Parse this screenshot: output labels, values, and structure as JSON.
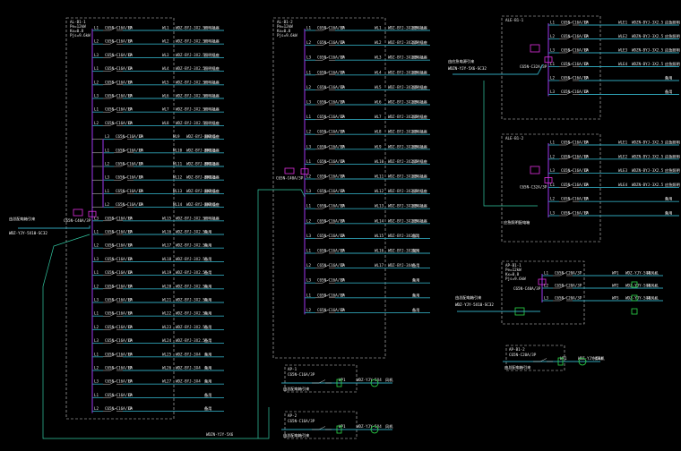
{
  "panels": [
    {
      "id": "AL-B1-1",
      "rows": [
        {
          "n": "L1",
          "brk": "C65N-C16A/1P",
          "a": "6A",
          "c": "WL1",
          "cable": "WDZ-BYJ-3X2.5",
          "load": "照明插座"
        },
        {
          "n": "L2",
          "brk": "C65N-C16A/1P",
          "a": "6A",
          "c": "WL2",
          "cable": "WDZ-BYJ-3X2.5",
          "load": "照明插座"
        },
        {
          "n": "L3",
          "brk": "C65N-C16A/1P",
          "a": "6A",
          "c": "WL3",
          "cable": "WDZ-BYJ-3X2.5",
          "load": "照明插座"
        },
        {
          "n": "L1",
          "brk": "C65N-C16A/1P",
          "a": "6A",
          "c": "WL4",
          "cable": "WDZ-BYJ-3X2.5",
          "load": "照明插座"
        },
        {
          "n": "L2",
          "brk": "C65N-C16A/1P",
          "a": "6A",
          "c": "WL5",
          "cable": "WDZ-BYJ-3X2.5",
          "load": "照明插座"
        },
        {
          "n": "L3",
          "brk": "C65N-C16A/1P",
          "a": "6A",
          "c": "WL6",
          "cable": "WDZ-BYJ-3X2.5",
          "load": "照明插座"
        },
        {
          "n": "L1",
          "brk": "C65N-C16A/1P",
          "a": "6A",
          "c": "WL7",
          "cable": "WDZ-BYJ-3X2.5",
          "load": "照明插座"
        },
        {
          "n": "L2",
          "brk": "C65N-C16A/1P",
          "a": "6A",
          "c": "WL8",
          "cable": "WDZ-BYJ-3X2.5",
          "load": "照明插座"
        },
        {
          "n": "L3",
          "brk": "C65N-C16A/1P",
          "a": "6A",
          "c": "WL9",
          "cable": "WDZ-BYJ-3X2.5",
          "load": "照明插座"
        },
        {
          "n": "L1",
          "brk": "C65N-C16A/1P",
          "a": "6A",
          "c": "WL10",
          "cable": "WDZ-BYJ-3X2.5",
          "load": "照明插座"
        },
        {
          "n": "L2",
          "brk": "C65N-C16A/1P",
          "a": "6A",
          "c": "WL11",
          "cable": "WDZ-BYJ-3X2.5",
          "load": "照明插座"
        },
        {
          "n": "L3",
          "brk": "C65N-C16A/1P",
          "a": "6A",
          "c": "WL12",
          "cable": "WDZ-BYJ-3X2.5",
          "load": "照明插座"
        },
        {
          "n": "L1",
          "brk": "C65N-C16A/1P",
          "a": "6A",
          "c": "WL13",
          "cable": "WDZ-BYJ-3X2.5",
          "load": "照明插座"
        },
        {
          "n": "L2",
          "brk": "C65N-C16A/1P",
          "a": "6A",
          "c": "WL14",
          "cable": "WDZ-BYJ-3X2.5",
          "load": "照明插座"
        },
        {
          "n": "L3",
          "brk": "C65N-C16A/1P",
          "a": "6A",
          "c": "WL15",
          "cable": "WDZ-BYJ-3X2.5",
          "load": "照明插座"
        },
        {
          "n": "L1",
          "brk": "C65N-C16A/1P",
          "a": "6A",
          "c": "WL16",
          "cable": "WDZ-BYJ-3X2.5",
          "load": "备用"
        },
        {
          "n": "L2",
          "brk": "C65N-C16A/1P",
          "a": "6A",
          "c": "WL17",
          "cable": "WDZ-BYJ-3X2.5",
          "load": "备用"
        },
        {
          "n": "L3",
          "brk": "C65N-C16A/1P",
          "a": "6A",
          "c": "WL18",
          "cable": "WDZ-BYJ-3X2.5",
          "load": "备用"
        },
        {
          "n": "L1",
          "brk": "C65N-C16A/1P",
          "a": "6A",
          "c": "WL19",
          "cable": "WDZ-BYJ-3X2.5",
          "load": "备用"
        },
        {
          "n": "L2",
          "brk": "C65N-C16A/1P",
          "a": "6A",
          "c": "WL20",
          "cable": "WDZ-BYJ-3X2.5",
          "load": "备用"
        },
        {
          "n": "L3",
          "brk": "C65N-C16A/1P",
          "a": "6A",
          "c": "WL21",
          "cable": "WDZ-BYJ-3X2.5",
          "load": "备用"
        },
        {
          "n": "L1",
          "brk": "C65N-C16A/1P",
          "a": "6A",
          "c": "WL22",
          "cable": "WDZ-BYJ-3X2.5",
          "load": "备用"
        },
        {
          "n": "L2",
          "brk": "C65N-C16A/1P",
          "a": "6A",
          "c": "WL23",
          "cable": "WDZ-BYJ-3X2.5",
          "load": "备用"
        },
        {
          "n": "L3",
          "brk": "C65N-C16A/1P",
          "a": "6A",
          "c": "WL24",
          "cable": "WDZ-BYJ-3X2.5",
          "load": "备用"
        },
        {
          "n": "L1",
          "brk": "C65N-C16A/1P",
          "a": "6A",
          "c": "WL25",
          "cable": "WDZ-BYJ-3X4",
          "load": "备用"
        },
        {
          "n": "L2",
          "brk": "C65N-C16A/1P",
          "a": "6A",
          "c": "WL26",
          "cable": "WDZ-BYJ-3X4",
          "load": "备用"
        },
        {
          "n": "L3",
          "brk": "C65N-C16A/1P",
          "a": "6A",
          "c": "WL27",
          "cable": "WDZ-BYJ-3X4",
          "load": "备用"
        },
        {
          "n": "L1",
          "brk": "C65N-C16A/1P",
          "a": "6A",
          "c": "",
          "cable": "",
          "load": "备用"
        },
        {
          "n": "L2",
          "brk": "C65N-C16A/1P",
          "a": "6A",
          "c": "",
          "cable": "",
          "load": "备用"
        }
      ],
      "incoming": "C65N-C40A/3P",
      "feeder": "WDZ-YJY-5X10-SC32",
      "source": "由总配电箱引来"
    },
    {
      "id": "AL-B1-2",
      "rows": [
        {
          "n": "L1",
          "brk": "C65N-C16A/1P",
          "a": "6A",
          "c": "WL1",
          "cable": "WDZ-BYJ-3X2.5",
          "load": "照明插座"
        },
        {
          "n": "L2",
          "brk": "C65N-C16A/1P",
          "a": "6A",
          "c": "WL2",
          "cable": "WDZ-BYJ-3X2.5",
          "load": "照明插座"
        },
        {
          "n": "L3",
          "brk": "C65N-C16A/1P",
          "a": "6A",
          "c": "WL3",
          "cable": "WDZ-BYJ-3X2.5",
          "load": "照明插座"
        },
        {
          "n": "L1",
          "brk": "C65N-C16A/1P",
          "a": "6A",
          "c": "WL4",
          "cable": "WDZ-BYJ-3X2.5",
          "load": "照明插座"
        },
        {
          "n": "L2",
          "brk": "C65N-C16A/1P",
          "a": "6A",
          "c": "WL5",
          "cable": "WDZ-BYJ-3X2.5",
          "load": "照明插座"
        },
        {
          "n": "L3",
          "brk": "C65N-C16A/1P",
          "a": "6A",
          "c": "WL6",
          "cable": "WDZ-BYJ-3X2.5",
          "load": "照明插座"
        },
        {
          "n": "L1",
          "brk": "C65N-C16A/1P",
          "a": "6A",
          "c": "WL7",
          "cable": "WDZ-BYJ-3X2.5",
          "load": "照明插座"
        },
        {
          "n": "L2",
          "brk": "C65N-C16A/1P",
          "a": "6A",
          "c": "WL8",
          "cable": "WDZ-BYJ-3X2.5",
          "load": "照明插座"
        },
        {
          "n": "L3",
          "brk": "C65N-C16A/1P",
          "a": "6A",
          "c": "WL9",
          "cable": "WDZ-BYJ-3X2.5",
          "load": "照明插座"
        },
        {
          "n": "L1",
          "brk": "C65N-C16A/1P",
          "a": "6A",
          "c": "WL10",
          "cable": "WDZ-BYJ-3X2.5",
          "load": "照明插座"
        },
        {
          "n": "L2",
          "brk": "C65N-C16A/1P",
          "a": "6A",
          "c": "WL11",
          "cable": "WDZ-BYJ-3X2.5",
          "load": "照明插座"
        },
        {
          "n": "L3",
          "brk": "C65N-C16A/1P",
          "a": "6A",
          "c": "WL12",
          "cable": "WDZ-BYJ-3X2.5",
          "load": "照明插座"
        },
        {
          "n": "L1",
          "brk": "C65N-C16A/1P",
          "a": "6A",
          "c": "WL13",
          "cable": "WDZ-BYJ-3X2.5",
          "load": "照明插座"
        },
        {
          "n": "L2",
          "brk": "C65N-C16A/1P",
          "a": "6A",
          "c": "WL14",
          "cable": "WDZ-BYJ-3X2.5",
          "load": "照明插座"
        },
        {
          "n": "L3",
          "brk": "C65N-C16A/1P",
          "a": "6A",
          "c": "WL15",
          "cable": "WDZ-BYJ-3X2.5",
          "load": "备用"
        },
        {
          "n": "L1",
          "brk": "C65N-C16A/1P",
          "a": "6A",
          "c": "WL16",
          "cable": "WDZ-BYJ-3X2.5",
          "load": "备用"
        },
        {
          "n": "L2",
          "brk": "C65N-C16A/1P",
          "a": "6A",
          "c": "WL17",
          "cable": "WDZ-BYJ-3X4",
          "load": "备用"
        },
        {
          "n": "L3",
          "brk": "C65N-C16A/1P",
          "a": "6A",
          "c": "",
          "cable": "",
          "load": "备用"
        },
        {
          "n": "L1",
          "brk": "C65N-C16A/1P",
          "a": "6A",
          "c": "",
          "cable": "",
          "load": "备用"
        },
        {
          "n": "L2",
          "brk": "C65N-C16A/1P",
          "a": "6A",
          "c": "",
          "cable": "",
          "load": "备用"
        }
      ],
      "incoming": "C65N-C40A/3P"
    },
    {
      "id": "ALE-B1-1",
      "rows": [
        {
          "n": "L1",
          "brk": "C65N-C16A/1P",
          "a": "6A",
          "c": "WLE1",
          "cable": "WDZN-BYJ-3X2.5",
          "load": "应急照明"
        },
        {
          "n": "L2",
          "brk": "C65N-C16A/1P",
          "a": "6A",
          "c": "WLE2",
          "cable": "WDZN-BYJ-3X2.5",
          "load": "应急照明"
        },
        {
          "n": "L3",
          "brk": "C65N-C16A/1P",
          "a": "6A",
          "c": "WLE3",
          "cable": "WDZN-BYJ-3X2.5",
          "load": "应急照明"
        },
        {
          "n": "L1",
          "brk": "C65N-C16A/1P",
          "a": "6A",
          "c": "WLE4",
          "cable": "WDZN-BYJ-3X2.5",
          "load": "应急照明"
        },
        {
          "n": "L2",
          "brk": "C65N-C16A/1P",
          "a": "6A",
          "c": "",
          "cable": "",
          "load": "备用"
        },
        {
          "n": "L3",
          "brk": "C65N-C16A/1P",
          "a": "6A",
          "c": "",
          "cable": "",
          "load": "备用"
        }
      ],
      "incoming": "C65N-C32A/3P",
      "feeder": "WDZN-YJY-5X6-SC32",
      "source": "由应急电源引来"
    },
    {
      "id": "ALE-B1-2",
      "rows": [
        {
          "n": "L1",
          "brk": "C65N-C16A/1P",
          "a": "6A",
          "c": "WLE1",
          "cable": "WDZN-BYJ-3X2.5",
          "load": "应急照明"
        },
        {
          "n": "L2",
          "brk": "C65N-C16A/1P",
          "a": "6A",
          "c": "WLE2",
          "cable": "WDZN-BYJ-3X2.5",
          "load": "应急照明"
        },
        {
          "n": "L3",
          "brk": "C65N-C16A/1P",
          "a": "6A",
          "c": "WLE3",
          "cable": "WDZN-BYJ-3X2.5",
          "load": "应急照明"
        },
        {
          "n": "L1",
          "brk": "C65N-C16A/1P",
          "a": "6A",
          "c": "WLE4",
          "cable": "WDZN-BYJ-3X2.5",
          "load": "应急照明"
        },
        {
          "n": "L2",
          "brk": "C65N-C16A/1P",
          "a": "6A",
          "c": "",
          "cable": "",
          "load": "备用"
        },
        {
          "n": "L3",
          "brk": "C65N-C16A/1P",
          "a": "6A",
          "c": "",
          "cable": "",
          "load": "备用"
        }
      ],
      "incoming": "C65N-C32A/3P",
      "note": "应急照明配电箱"
    },
    {
      "id": "AP-B1-1",
      "rows": [
        {
          "n": "L1",
          "brk": "C65N-C20A/3P",
          "a": "",
          "c": "WP1",
          "cable": "WDZ-YJY-5X4",
          "load": "排风机"
        },
        {
          "n": "L2",
          "brk": "C65N-C20A/3P",
          "a": "",
          "c": "WP2",
          "cable": "WDZ-YJY-5X4",
          "load": "排风机"
        },
        {
          "n": "L3",
          "brk": "C65N-C20A/3P",
          "a": "",
          "c": "WP3",
          "cable": "WDZ-YJY-5X4",
          "load": "排风机"
        }
      ],
      "incoming": "C65N-C40A/3P",
      "feeder": "WDZ-YJY-5X10-SC32",
      "source": "由总配电箱引来"
    },
    {
      "id": "AP-B1-2",
      "rows": [
        {
          "n": "",
          "brk": "C65N-C20A/3P",
          "a": "",
          "c": "WP1",
          "cable": "WDZ-YJY-5X4",
          "load": "排风机"
        }
      ],
      "incoming": "C65N-C20A/3P"
    },
    {
      "id": "AP-1",
      "rows": [
        {
          "n": "",
          "brk": "C65N-C16A/3P",
          "a": "",
          "c": "WP1",
          "cable": "WDZ-YJY-5X4",
          "load": "风机"
        }
      ],
      "incoming": "C65N-C16A/3P"
    },
    {
      "id": "AP-2",
      "rows": [
        {
          "n": "",
          "brk": "C65N-C16A/3P",
          "a": "",
          "c": "WP1",
          "cable": "WDZ-YJY-5X4",
          "load": "风机"
        }
      ],
      "incoming": "C65N-C16A/3P"
    }
  ],
  "panel_params": {
    "pe": "Pe=12kW",
    "kx": "Kx=0.8",
    "pjs": "Pjs=9.6kW"
  },
  "bottom_feeder": "WDZN-YJY-5X6"
}
